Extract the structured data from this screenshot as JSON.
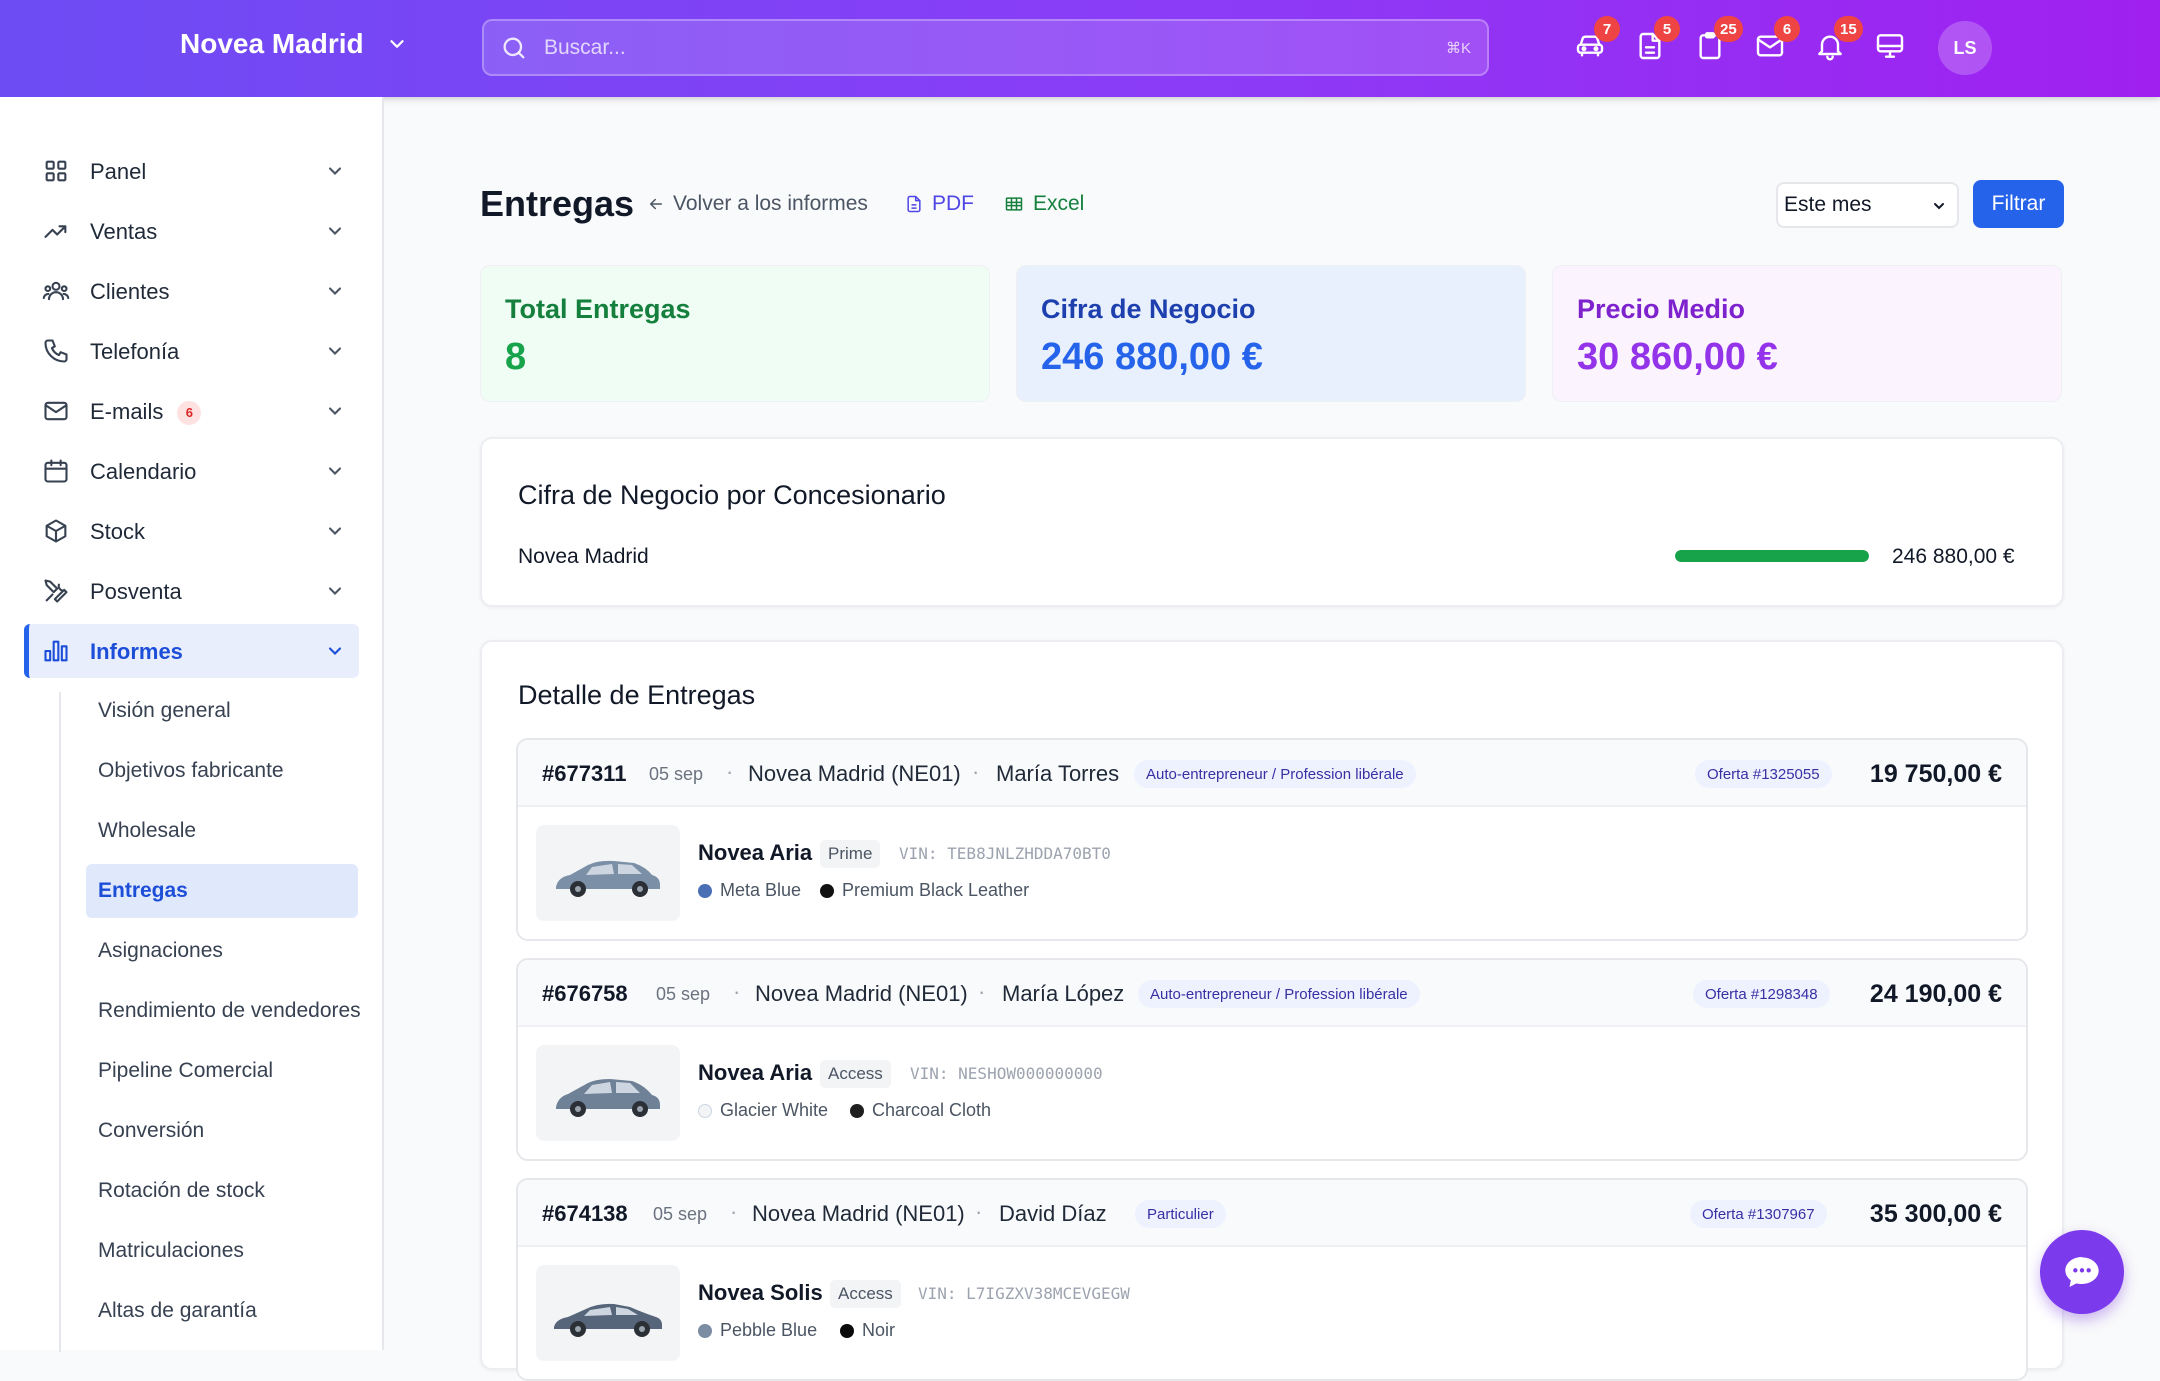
{
  "header": {
    "brand": "Novea Madrid",
    "search_placeholder": "Buscar...",
    "search_shortcut": "⌘K",
    "badges": {
      "cars": "7",
      "documents": "5",
      "clipboard": "25",
      "mail": "6",
      "bell": "15"
    },
    "avatar": "LS"
  },
  "sidebar": {
    "items": [
      {
        "label": "Panel"
      },
      {
        "label": "Ventas"
      },
      {
        "label": "Clientes"
      },
      {
        "label": "Telefonía"
      },
      {
        "label": "E-mails",
        "badge": "6"
      },
      {
        "label": "Calendario"
      },
      {
        "label": "Stock"
      },
      {
        "label": "Posventa"
      },
      {
        "label": "Informes"
      }
    ],
    "sub_items": [
      "Visión general",
      "Objetivos fabricante",
      "Wholesale",
      "Entregas",
      "Asignaciones",
      "Rendimiento de vendedores",
      "Pipeline Comercial",
      "Conversión",
      "Rotación de stock",
      "Matriculaciones",
      "Altas de garantía"
    ]
  },
  "page": {
    "title": "Entregas",
    "back_label": "Volver a los informes",
    "pdf_label": "PDF",
    "excel_label": "Excel",
    "period": "Este mes",
    "filter_label": "Filtrar"
  },
  "cards": {
    "total": {
      "label": "Total Entregas",
      "value": "8",
      "bg": "#effdf4",
      "color": "#15803d",
      "valcolor": "#16a34a"
    },
    "revenue": {
      "label": "Cifra de Negocio",
      "value": "246 880,00 €",
      "bg": "#e8effd",
      "color": "#1e40af",
      "valcolor": "#2563eb"
    },
    "avg": {
      "label": "Precio Medio",
      "value": "30 860,00 €",
      "bg": "#fbf3fe",
      "color": "#7e22ce",
      "valcolor": "#9333ea"
    }
  },
  "by_dealer": {
    "title": "Cifra de Negocio por Concesionario",
    "rows": [
      {
        "name": "Novea Madrid",
        "value": "246 880,00 €",
        "share": 1.0
      }
    ]
  },
  "details": {
    "title": "Detalle de Entregas",
    "deliveries": [
      {
        "id": "#677311",
        "date": "05 sep",
        "dealer": "Novea Madrid (NE01)",
        "client": "María Torres",
        "type": "Auto-entrepreneur / Profession libérale",
        "offer": "Oferta #1325055",
        "price": "19 750,00 €",
        "model": "Novea Aria",
        "trim": "Prime",
        "vin": "VIN: TEB8JNLZHDDA70BT0",
        "ext_color": "Meta Blue",
        "ext_hex": "#4a6fb5",
        "int_color": "Premium Black Leather",
        "int_hex": "#111111"
      },
      {
        "id": "#676758",
        "date": "05 sep",
        "dealer": "Novea Madrid (NE01)",
        "client": "María López",
        "type": "Auto-entrepreneur / Profession libérale",
        "offer": "Oferta #1298348",
        "price": "24 190,00 €",
        "model": "Novea Aria",
        "trim": "Access",
        "vin": "VIN: NESHOW000000000",
        "ext_color": "Glacier White",
        "ext_hex": "#f3f4f6",
        "int_color": "Charcoal Cloth",
        "int_hex": "#1f1f1f"
      },
      {
        "id": "#674138",
        "date": "05 sep",
        "dealer": "Novea Madrid (NE01)",
        "client": "David Díaz",
        "type": "Particulier",
        "offer": "Oferta #1307967",
        "price": "35 300,00 €",
        "model": "Novea Solis",
        "trim": "Access",
        "vin": "VIN: L7IGZXV38MCEVGEGW",
        "ext_color": "Pebble Blue",
        "ext_hex": "#7b8ca3",
        "int_color": "Noir",
        "int_hex": "#0a0a0a"
      }
    ]
  }
}
